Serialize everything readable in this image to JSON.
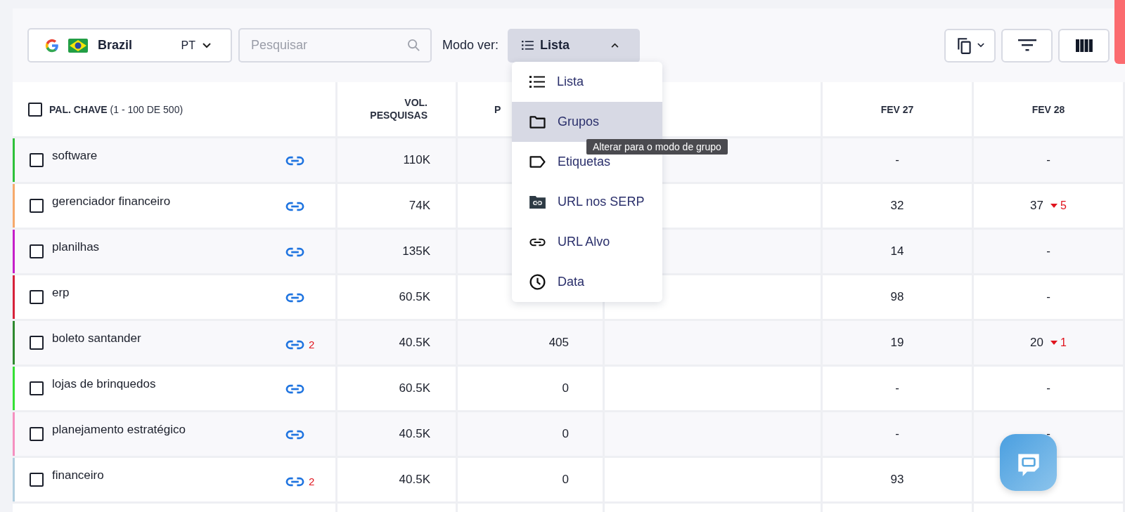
{
  "toolbar": {
    "engine": {
      "country": "Brazil",
      "language": "PT"
    },
    "search": {
      "placeholder": "Pesquisar"
    },
    "view_mode": {
      "label": "Modo ver:",
      "value": "Lista",
      "expanded": true
    }
  },
  "view_menu": {
    "items": [
      {
        "label": "Lista",
        "kind": "list",
        "highlighted": false
      },
      {
        "label": "Grupos",
        "kind": "folder",
        "highlighted": true
      },
      {
        "label": "Etiquetas",
        "kind": "tag",
        "highlighted": false
      },
      {
        "label": "URL nos SERP",
        "kind": "serp",
        "highlighted": false
      },
      {
        "label": "URL Alvo",
        "kind": "link",
        "highlighted": false
      },
      {
        "label": "Data",
        "kind": "clock",
        "highlighted": false
      }
    ],
    "tooltip": "Alterar para o modo de grupo"
  },
  "table": {
    "header": {
      "checked": false,
      "keyword": "PAL. CHAVE",
      "keyword_count": "(1 - 100 DE 500)",
      "volume": "VOL. PESQUISAS",
      "column_3": "P",
      "date_1": "FEV 27",
      "date_2": "FEV 28"
    },
    "rows": [
      {
        "keyword": "software",
        "color": "#2fc13a",
        "checked": false,
        "volume": "110K",
        "date_1": "-",
        "date_2": "-"
      },
      {
        "keyword": "gerenciador financeiro",
        "color": "#f6a96b",
        "checked": false,
        "volume": "74K",
        "date_1": "32",
        "date_2": "37",
        "date_2_drop": "5"
      },
      {
        "keyword": "planilhas",
        "color": "#c51fc9",
        "checked": false,
        "volume": "135K",
        "date_1": "14",
        "date_2": "-"
      },
      {
        "keyword": "erp",
        "color": "#d7223a",
        "checked": false,
        "volume": "60.5K",
        "date_1": "98",
        "date_2": "-"
      },
      {
        "keyword": "boleto santander",
        "color": "#2f8a2f",
        "checked": false,
        "url_count": "2",
        "volume": "40.5K",
        "column_3": "405",
        "date_1": "19",
        "date_2": "20",
        "date_2_drop": "1"
      },
      {
        "keyword": "lojas de brinquedos",
        "color": "#35e035",
        "checked": false,
        "volume": "60.5K",
        "column_3": "0",
        "date_1": "-",
        "date_2": "-"
      },
      {
        "keyword": "planejamento estratégico",
        "color": "#f590c0",
        "checked": false,
        "volume": "40.5K",
        "column_3": "0",
        "date_1": "-",
        "date_2": "-"
      },
      {
        "keyword": "financeiro",
        "color": "#b2cfe0",
        "checked": false,
        "url_count": "2",
        "volume": "40.5K",
        "column_3": "0",
        "date_1": "93"
      }
    ]
  }
}
